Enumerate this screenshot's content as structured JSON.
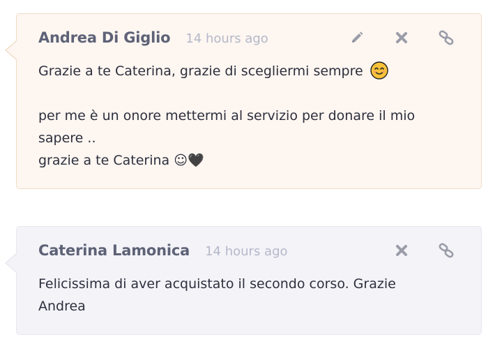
{
  "comments": [
    {
      "author": "Andrea Di Giglio",
      "time": "14 hours ago",
      "line1": "Grazie a te Caterina, grazie di scegliermi sempre",
      "line2": "per me è un onore mettermi al servizio per donare il mio sapere ..",
      "line3_text": "grazie a te Caterina ☺",
      "line3_heart": "🖤",
      "actions": [
        "edit-icon",
        "delete-icon",
        "link-icon"
      ]
    },
    {
      "author": "Caterina Lamonica",
      "time": "14 hours ago",
      "line1": "Felicissima di aver acquistato il secondo corso. Grazie Andrea",
      "actions": [
        "delete-icon",
        "link-icon"
      ]
    }
  ],
  "colors": {
    "highlight_bg": "#fdf6f1",
    "normal_bg": "#f3f3f8",
    "author": "#5e6277",
    "time": "#b5b8c9",
    "icon": "#9a9ca8"
  }
}
